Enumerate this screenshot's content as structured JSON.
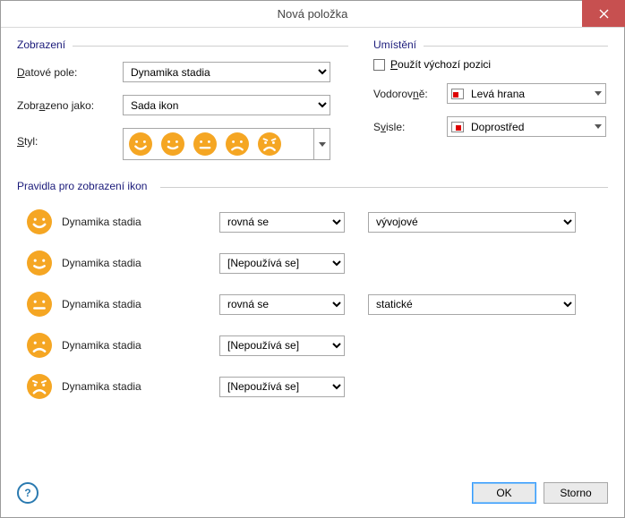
{
  "window": {
    "title": "Nová položka"
  },
  "display": {
    "group_label": "Zobrazení",
    "data_field_label_html": "<span class='underline-char'>D</span>atové pole:",
    "data_field_value": "Dynamika stadia",
    "shown_as_label_html": "Zobr<span class='underline-char'>a</span>zeno jako:",
    "shown_as_value": "Sada ikon",
    "style_label_html": "<span class='underline-char'>S</span>tyl:"
  },
  "placement": {
    "group_label": "Umístění",
    "use_default_label_html": "<span class='underline-char'>P</span>oužít výchozí pozici",
    "use_default_checked": false,
    "horizontal_label_html": "Vodorov<span class='underline-char'>n</span>ě:",
    "horizontal_value": "Levá hrana",
    "vertical_label_html": "S<span class='underline-char'>v</span>isle:",
    "vertical_value": "Doprostřed"
  },
  "rules": {
    "group_label": "Pravidla pro zobrazení ikon",
    "field_name": "Dynamika stadia",
    "items": [
      {
        "face": "happy",
        "op": "rovná se",
        "val": "vývojové"
      },
      {
        "face": "smile",
        "op": "[Nepoužívá se]",
        "val": null
      },
      {
        "face": "neutral",
        "op": "rovná se",
        "val": "statické"
      },
      {
        "face": "sad",
        "op": "[Nepoužívá se]",
        "val": null
      },
      {
        "face": "cry",
        "op": "[Nepoužívá se]",
        "val": null
      }
    ]
  },
  "buttons": {
    "ok": "OK",
    "cancel": "Storno"
  },
  "icons": {
    "faces_order": [
      "happy",
      "smile",
      "neutral",
      "sad",
      "cry"
    ]
  }
}
